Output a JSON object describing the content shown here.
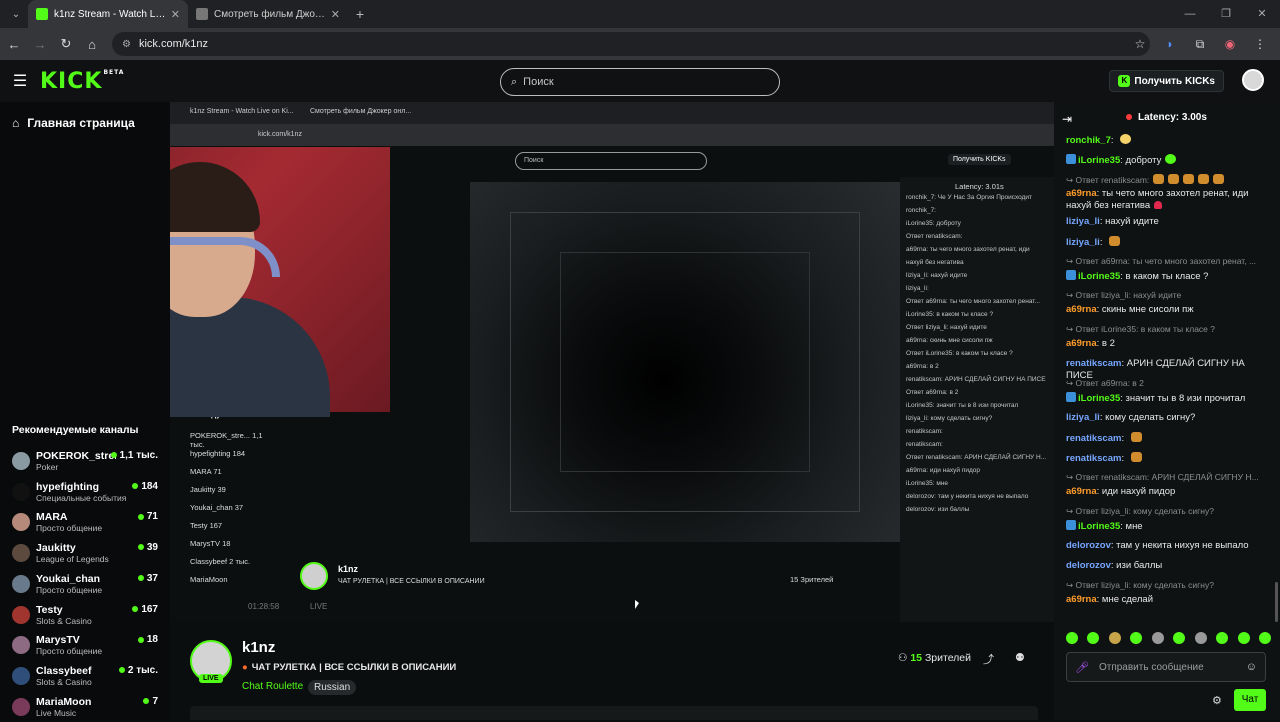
{
  "browser": {
    "tabs": [
      {
        "title": "k1nz Stream - Watch Live on Kick",
        "active": true,
        "fav_color": "#53fc18"
      },
      {
        "title": "Смотреть фильм Джокер онлайн",
        "active": false,
        "fav_color": "#777777"
      }
    ],
    "url": "kick.com/k1nz"
  },
  "header": {
    "logo": "KICK",
    "logo_sup": "BETA",
    "search_placeholder": "Поиск",
    "get_kicks": "Получить KICKs"
  },
  "sidebar": {
    "home": "Главная страница",
    "recommended_title": "Рекомендуемые каналы",
    "channels": [
      {
        "name": "POKEROK_stre...",
        "category": "Poker",
        "viewers": "1,1 тыс.",
        "color": "#8a9aa3"
      },
      {
        "name": "hypefighting",
        "category": "Специальные события",
        "viewers": "184",
        "color": "#111111"
      },
      {
        "name": "MARA",
        "category": "Просто общение",
        "viewers": "71",
        "color": "#b58a7a"
      },
      {
        "name": "Jaukitty",
        "category": "League of Legends",
        "viewers": "39",
        "color": "#5c4a3f"
      },
      {
        "name": "Youkai_chan",
        "category": "Просто общение",
        "viewers": "37",
        "color": "#6a7a8d"
      },
      {
        "name": "Testy",
        "category": "Slots & Casino",
        "viewers": "167",
        "color": "#a0342f"
      },
      {
        "name": "MarysTV",
        "category": "Просто общение",
        "viewers": "18",
        "color": "#8d6b83"
      },
      {
        "name": "Classybeef",
        "category": "Slots & Casino",
        "viewers": "2 тыс.",
        "color": "#2f4f7a"
      },
      {
        "name": "MariaMoon",
        "category": "Live Music",
        "viewers": "7",
        "color": "#7a3a5a"
      }
    ]
  },
  "inner": {
    "tab1": "k1nz Stream - Watch Live on Ki...",
    "tab2": "Смотреть фильм Джокер онл...",
    "url": "kick.com/k1nz",
    "search": "Поиск",
    "get_kicks": "Получить KICKs",
    "latency": "Latency: 3.01s",
    "chat_lines": [
      "ronchik_7: Че У Нас За Оргия Происходит",
      "ronchik_7:",
      "iLorine35: доброту",
      "Ответ renatikscam:",
      "a69rna: ты чего много захотел ренат, иди",
      "нахуй без негатива",
      "liziya_li: нахуй идите",
      "liziya_li:",
      "Ответ a69rna: ты чего много захотел ренат...",
      "iLorine35: в каком ты класе ?",
      "Ответ liziya_li: нахуй идите",
      "a69rna: скинь мне сисоли пж",
      "Ответ iLorine35: в каком ты класе ?",
      "a69rna: в 2",
      "renatikscam: АРИН СДЕЛАЙ СИГНУ НА ПИСЕ",
      "Ответ a69rna: в 2",
      "iLorine35: значит ты в 8 изи прочитал",
      "liziya_li: кому сделать сигну?",
      "renatikscam:",
      "renatikscam:",
      "Ответ renatikscam: АРИН СДЕЛАЙ СИГНУ Н...",
      "a69rna: иди нахуй пидор",
      "iLorine35: мне",
      "delorozov: там у некита нихуя не выпало",
      "delorozov: изи баллы"
    ],
    "recommended_title": "Рекомендуемые каналы",
    "rec": [
      "POKEROK_stre... 1,1 тыс.",
      "hypefighting 184",
      "MARA 71",
      "Jaukitty 39",
      "Youkai_chan 37",
      "Testy 167",
      "MarysTV 18",
      "Classybeef 2 тыс.",
      "MariaMoon"
    ],
    "streamer": "k1nz",
    "title": "ЧАТ РУЛЕТКА | ВСЕ ССЫЛКИ В ОПИСАНИИ",
    "viewers": "15 Зрителей",
    "time": "01:28:58",
    "live": "LIVE"
  },
  "stream": {
    "name": "k1nz",
    "title": "ЧАТ РУЛЕТКА | ВСЕ ССЫЛКИ В ОПИСАНИИ",
    "category": "Chat Roulette",
    "language": "Russian",
    "live_badge": "LIVE",
    "viewers_count": "15",
    "viewers_label": "Зрителей"
  },
  "chat": {
    "latency": "Latency: 3.00s",
    "messages": [
      {
        "type": "msg",
        "user": "ronchik_7",
        "color": "#53fc18",
        "badge": false,
        "text": "",
        "emotes": [
          "y"
        ]
      },
      {
        "type": "msg",
        "user": "iLorine35",
        "color": "#53fc18",
        "badge": true,
        "text": "доброту",
        "emotes": [
          "g"
        ]
      },
      {
        "type": "reply",
        "text": "Ответ renatikscam:",
        "emotes": [
          "o",
          "o",
          "o",
          "o",
          "o"
        ]
      },
      {
        "type": "msg",
        "user": "a69rna",
        "color": "#ff9d2a",
        "badge": false,
        "text": "ты чето много захотел ренат, иди нахуй без негатива",
        "emotes": [
          "h"
        ]
      },
      {
        "type": "msg",
        "user": "liziya_li",
        "color": "#76a6ff",
        "badge": false,
        "text": "нахуй идите",
        "emotes": []
      },
      {
        "type": "msg",
        "user": "liziya_li",
        "color": "#76a6ff",
        "badge": false,
        "text": "",
        "emotes": [
          "o"
        ]
      },
      {
        "type": "reply",
        "text": "Ответ a69rna: ты чето много захотел ренат, ...",
        "emotes": []
      },
      {
        "type": "msg",
        "user": "iLorine35",
        "color": "#53fc18",
        "badge": true,
        "text": "в каком ты класе ?",
        "emotes": []
      },
      {
        "type": "reply",
        "text": "Ответ liziya_li: нахуй идите",
        "emotes": []
      },
      {
        "type": "msg",
        "user": "a69rna",
        "color": "#ff9d2a",
        "badge": false,
        "text": "скинь мне сисоли пж",
        "emotes": []
      },
      {
        "type": "reply",
        "text": "Ответ iLorine35: в каком ты класе ?",
        "emotes": []
      },
      {
        "type": "msg",
        "user": "a69rna",
        "color": "#ff9d2a",
        "badge": false,
        "text": "в 2",
        "emotes": []
      },
      {
        "type": "msg",
        "user": "renatikscam",
        "color": "#76a6ff",
        "badge": false,
        "text": "АРИН СДЕЛАЙ СИГНУ НА ПИСЕ",
        "emotes": []
      },
      {
        "type": "reply",
        "text": "Ответ a69rna: в 2",
        "emotes": []
      },
      {
        "type": "msg",
        "user": "iLorine35",
        "color": "#53fc18",
        "badge": true,
        "text": "значит ты в 8 изи прочитал",
        "emotes": []
      },
      {
        "type": "msg",
        "user": "liziya_li",
        "color": "#76a6ff",
        "badge": false,
        "text": "кому сделать сигну?",
        "emotes": []
      },
      {
        "type": "msg",
        "user": "renatikscam",
        "color": "#76a6ff",
        "badge": false,
        "text": "",
        "emotes": [
          "o"
        ]
      },
      {
        "type": "msg",
        "user": "renatikscam",
        "color": "#76a6ff",
        "badge": false,
        "text": "",
        "emotes": [
          "o"
        ]
      },
      {
        "type": "reply",
        "text": "Ответ renatikscam: АРИН СДЕЛАЙ СИГНУ Н...",
        "emotes": []
      },
      {
        "type": "msg",
        "user": "a69rna",
        "color": "#ff9d2a",
        "badge": false,
        "text": "иди нахуй пидор",
        "emotes": []
      },
      {
        "type": "reply",
        "text": "Ответ liziya_li: кому сделать сигну?",
        "emotes": []
      },
      {
        "type": "msg",
        "user": "iLorine35",
        "color": "#53fc18",
        "badge": true,
        "text": "мне",
        "emotes": []
      },
      {
        "type": "msg",
        "user": "delorozov",
        "color": "#76a6ff",
        "badge": false,
        "text": "там у некита нихуя не выпало",
        "emotes": []
      },
      {
        "type": "msg",
        "user": "delorozov",
        "color": "#76a6ff",
        "badge": false,
        "text": "изи баллы",
        "emotes": []
      },
      {
        "type": "reply",
        "text": "Ответ liziya_li: кому сделать сигну?",
        "emotes": []
      },
      {
        "type": "msg",
        "user": "a69rna",
        "color": "#ff9d2a",
        "badge": false,
        "text": "мне сделай",
        "emotes": []
      }
    ],
    "input_placeholder": "Отправить сообщение",
    "send": "Чат"
  },
  "icons": {
    "back": "arrow-left-icon",
    "forward": "arrow-right-icon",
    "reload": "reload-icon",
    "home": "home-icon",
    "search": "search-icon",
    "menu": "hamburger-icon",
    "share": "share-icon",
    "follow": "user-plus-icon",
    "mic": "mic-icon",
    "emoji": "smile-icon",
    "gear": "gear-icon"
  },
  "colors": {
    "kick_green": "#53fc18",
    "bg": "#0b0e0f"
  }
}
